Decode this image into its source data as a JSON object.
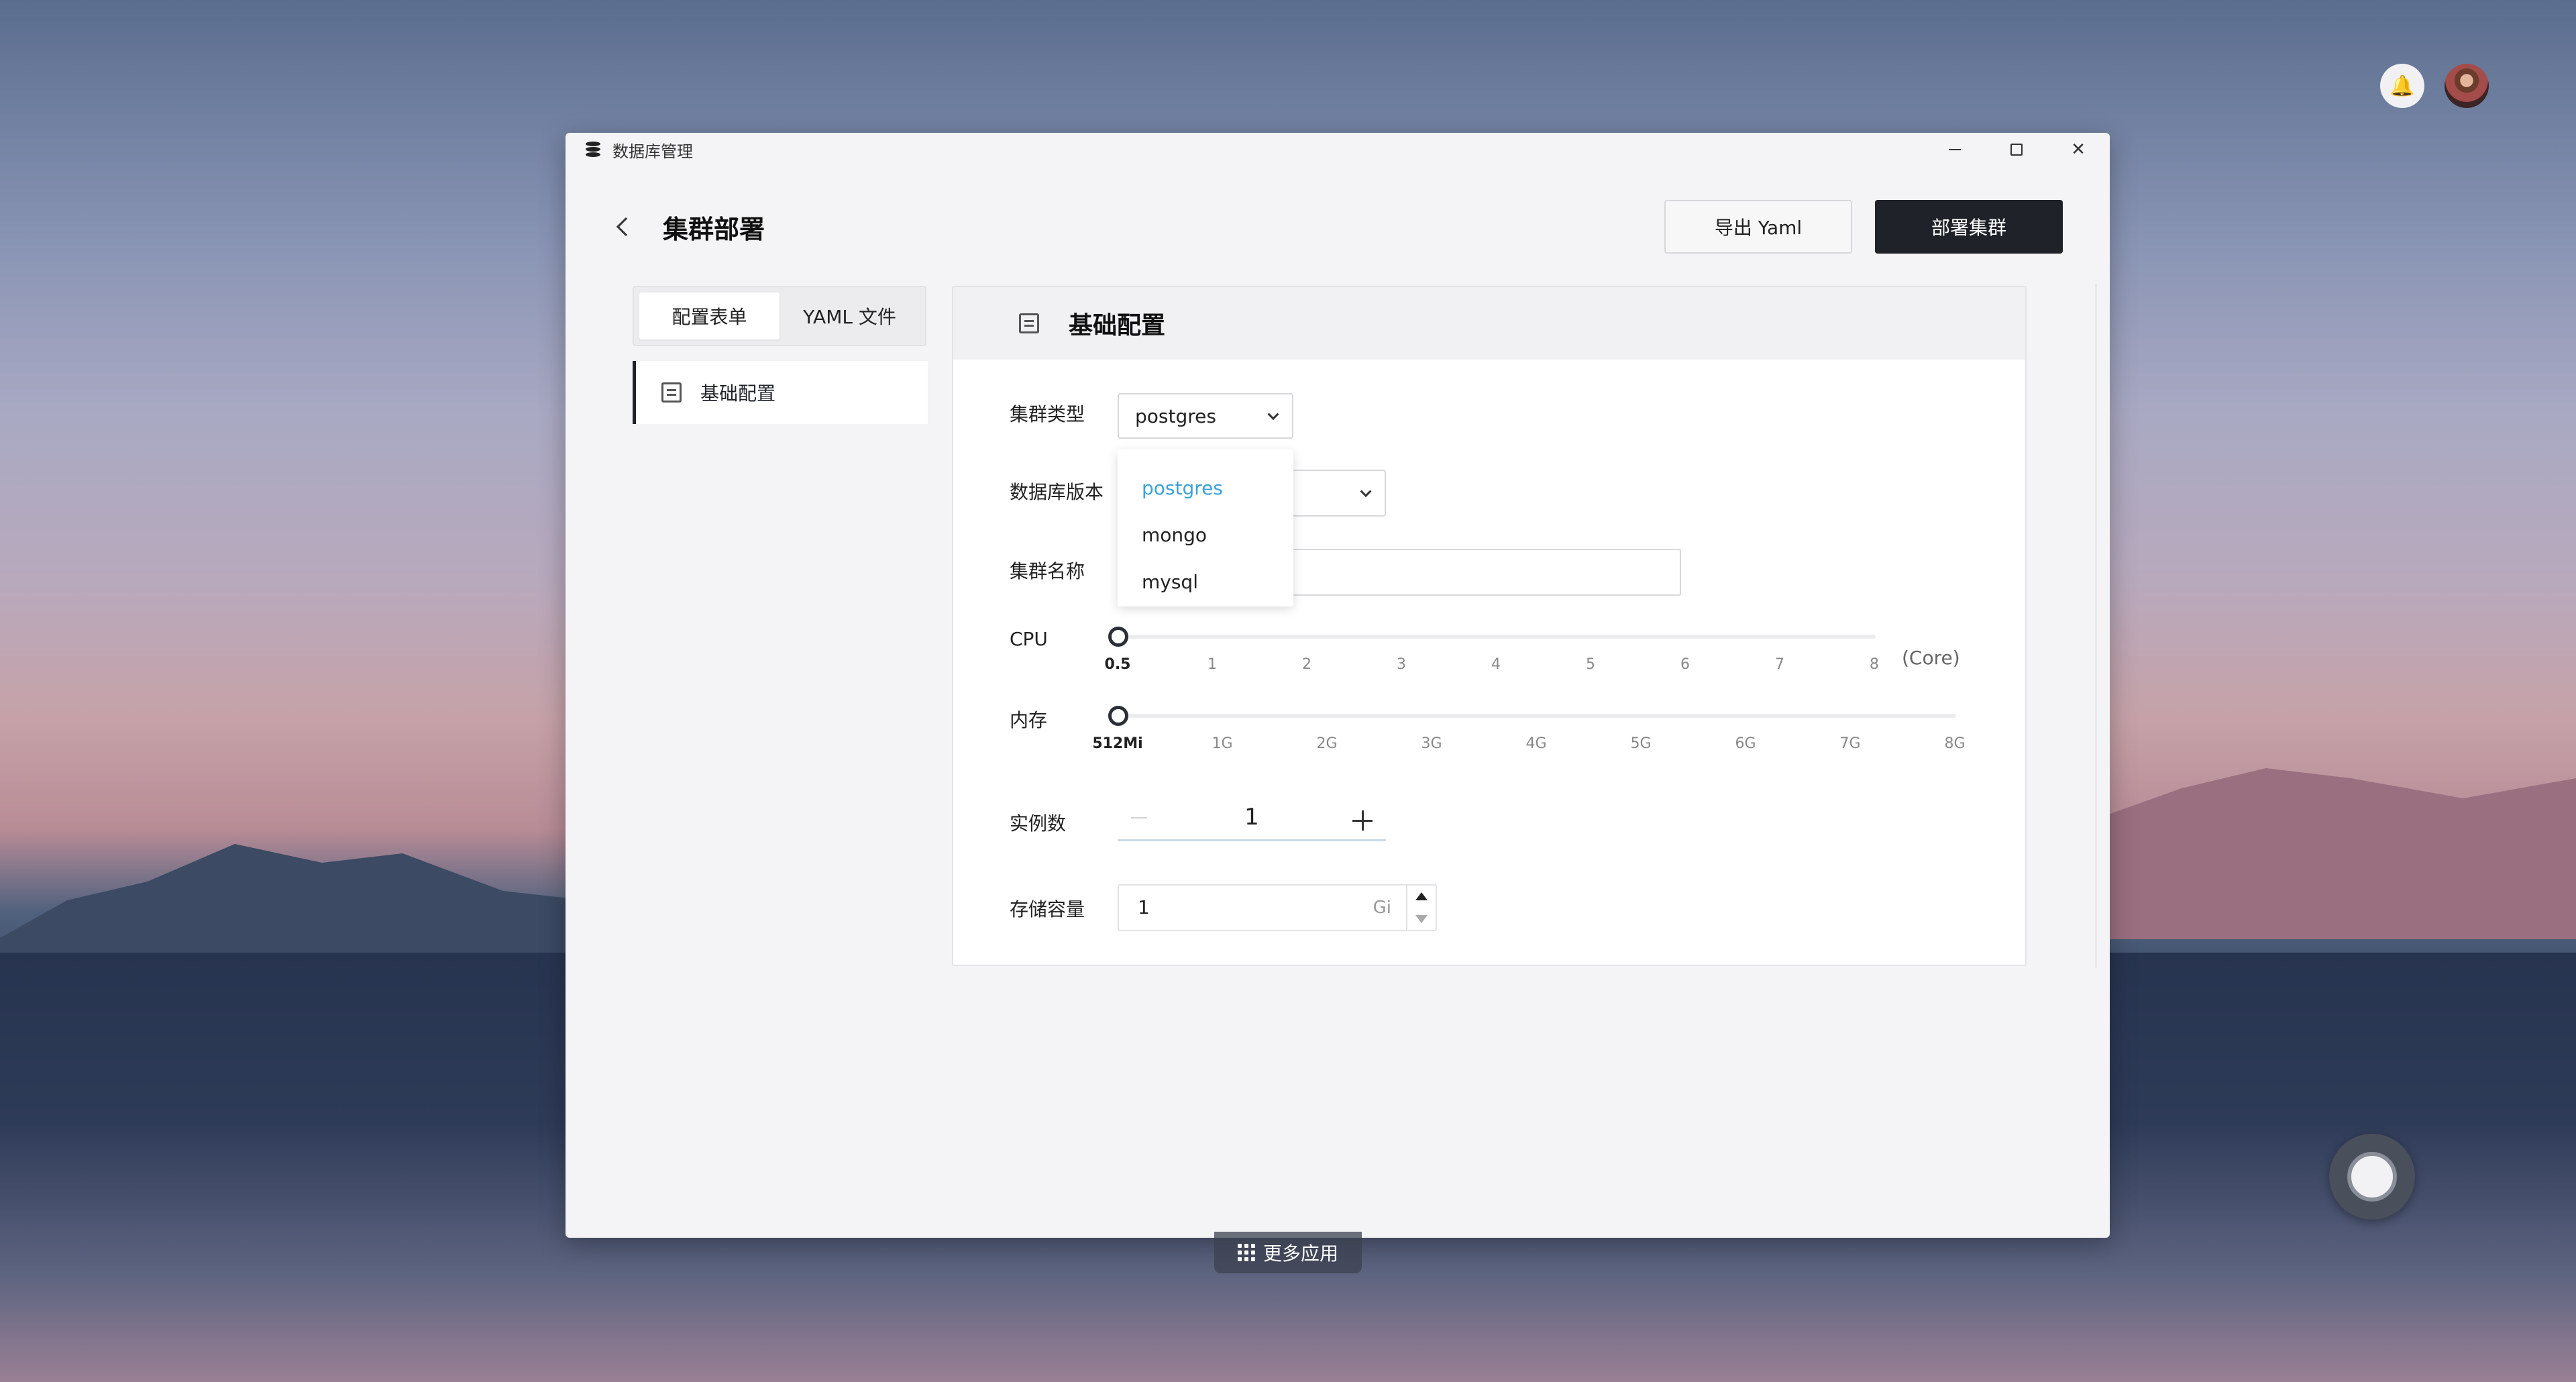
{
  "window": {
    "title": "数据库管理"
  },
  "header": {
    "title": "集群部署",
    "export_label": "导出 Yaml",
    "deploy_label": "部署集群"
  },
  "tabs": [
    {
      "label": "配置表单",
      "active": true
    },
    {
      "label": "YAML 文件",
      "active": false
    }
  ],
  "nav": {
    "items": [
      {
        "label": "基础配置",
        "icon": "document-icon",
        "active": true
      }
    ]
  },
  "panel": {
    "title": "基础配置"
  },
  "form": {
    "cluster_type": {
      "label": "集群类型",
      "value": "postgres"
    },
    "db_version": {
      "label": "数据库版本",
      "value": ""
    },
    "cluster_name": {
      "label": "集群名称",
      "value": ""
    },
    "cpu": {
      "label": "CPU",
      "value": "0.5",
      "ticks": [
        "0.5",
        "1",
        "2",
        "3",
        "4",
        "5",
        "6",
        "7",
        "8"
      ],
      "unit": "(Core)"
    },
    "memory": {
      "label": "内存",
      "value": "512Mi",
      "ticks": [
        "512Mi",
        "1G",
        "2G",
        "3G",
        "4G",
        "5G",
        "6G",
        "7G",
        "8G"
      ]
    },
    "instances": {
      "label": "实例数",
      "value": "1"
    },
    "storage": {
      "label": "存储容量",
      "value": "1",
      "unit": "Gi"
    }
  },
  "dropdown": {
    "options": [
      "postgres",
      "mongo",
      "mysql"
    ],
    "selected": "postgres",
    "selected_color": "#3aa3d8"
  },
  "taskbar": {
    "more_apps_label": "更多应用"
  },
  "colors": {
    "primary_button": "#1f2329",
    "accent": "#3aa3d8"
  }
}
